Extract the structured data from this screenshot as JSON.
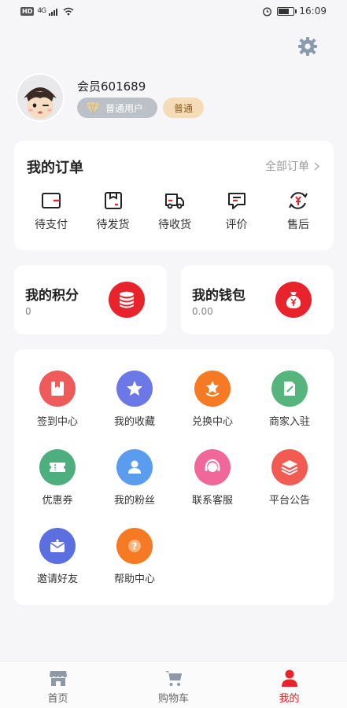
{
  "status_bar": {
    "hd_label": "HD",
    "network": "4G",
    "time": "16:09"
  },
  "profile": {
    "username": "会员601689",
    "level_badge": "普通用户",
    "tier_badge": "普通"
  },
  "orders": {
    "title": "我的订单",
    "all_orders": "全部订单",
    "items": [
      {
        "label": "待支付",
        "icon": "wallet-card-icon"
      },
      {
        "label": "待发货",
        "icon": "package-icon"
      },
      {
        "label": "待收货",
        "icon": "truck-icon"
      },
      {
        "label": "评价",
        "icon": "comment-icon"
      },
      {
        "label": "售后",
        "icon": "refund-icon"
      }
    ]
  },
  "points": {
    "title": "我的积分",
    "value": "0",
    "icon": "coins-stack-icon"
  },
  "wallet": {
    "title": "我的钱包",
    "value": "0.00",
    "icon": "money-bag-icon"
  },
  "services": [
    {
      "label": "签到中心",
      "icon": "checkin-icon",
      "color": "#ef5a5a"
    },
    {
      "label": "我的收藏",
      "icon": "star-icon",
      "color": "#6b78e5"
    },
    {
      "label": "兑换中心",
      "icon": "exchange-icon",
      "color": "#f57a23"
    },
    {
      "label": "商家入驻",
      "icon": "merchant-icon",
      "color": "#56b57c"
    },
    {
      "label": "优惠券",
      "icon": "coupon-icon",
      "color": "#4caf7d"
    },
    {
      "label": "我的粉丝",
      "icon": "fans-icon",
      "color": "#5a9cf0"
    },
    {
      "label": "联系客服",
      "icon": "headset-icon",
      "color": "#f0679a"
    },
    {
      "label": "平台公告",
      "icon": "layers-icon",
      "color": "#f25b52"
    },
    {
      "label": "邀请好友",
      "icon": "invite-icon",
      "color": "#5b6fe0"
    },
    {
      "label": "帮助中心",
      "icon": "help-icon",
      "color": "#f57a23"
    }
  ],
  "tabs": [
    {
      "label": "首页",
      "icon": "home-store-icon"
    },
    {
      "label": "购物车",
      "icon": "cart-icon"
    },
    {
      "label": "我的",
      "icon": "person-icon",
      "active": true
    }
  ],
  "colors": {
    "accent": "#e8232b",
    "background": "#f6f6f8"
  }
}
